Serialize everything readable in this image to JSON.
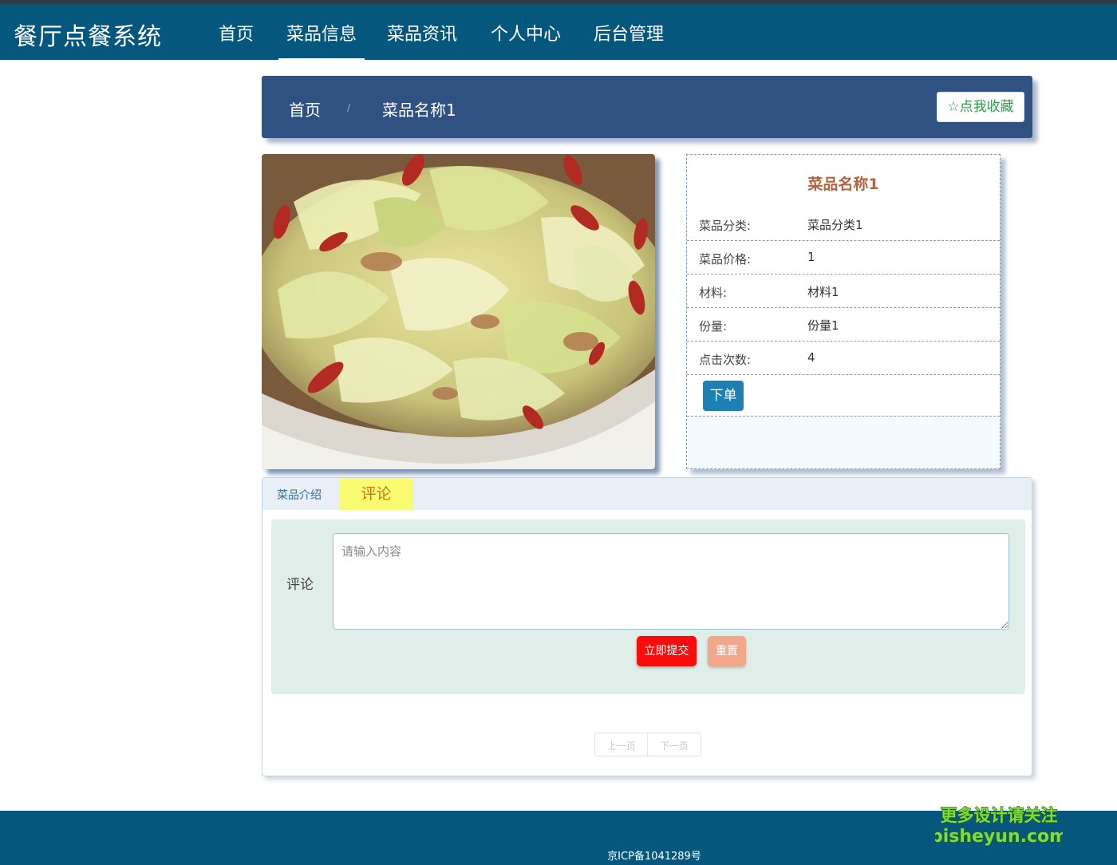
{
  "app": {
    "title": "餐厅点餐系统"
  },
  "nav": {
    "items": [
      {
        "label": "首页",
        "active": false
      },
      {
        "label": "菜品信息",
        "active": true
      },
      {
        "label": "菜品资讯",
        "active": false
      },
      {
        "label": "个人中心",
        "active": false
      },
      {
        "label": "后台管理",
        "active": false
      }
    ]
  },
  "breadcrumb": {
    "home": "首页",
    "separator": "/",
    "current": "菜品名称1"
  },
  "favorite": {
    "icon": "star-outline-icon",
    "label": "点我收藏"
  },
  "dish": {
    "image": "food-photo",
    "name": "菜品名称1",
    "fields": [
      {
        "label": "菜品分类:",
        "value": "菜品分类1"
      },
      {
        "label": "菜品价格:",
        "value": "1"
      },
      {
        "label": "材料:",
        "value": "材料1"
      },
      {
        "label": "份量:",
        "value": "份量1"
      },
      {
        "label": "点击次数:",
        "value": "4"
      }
    ],
    "order_label": "下单"
  },
  "tabs": [
    {
      "label": "菜品介绍",
      "active": false
    },
    {
      "label": "评论",
      "active": true
    }
  ],
  "comment": {
    "label": "评论",
    "placeholder": "请输入内容",
    "submit_label": "立即提交",
    "reset_label": "重置"
  },
  "pager": {
    "prev_label": "上一页",
    "next_label": "下一页"
  },
  "footer": {
    "icp": "京ICP备1041289号"
  },
  "watermark": {
    "line1": "更多设计请关注",
    "line2": "bisheyun.com"
  },
  "colors": {
    "navbar": "#06577e",
    "breadcrumb_bar": "#2f5283",
    "dish_title": "#b06540",
    "order_button": "#1c80b5",
    "active_tab": "#fbfb72",
    "submit_button": "#f80d0d",
    "reset_button": "#f2a78b",
    "favorite_text": "#2d9e47",
    "comment_bg": "#dfeee9"
  }
}
